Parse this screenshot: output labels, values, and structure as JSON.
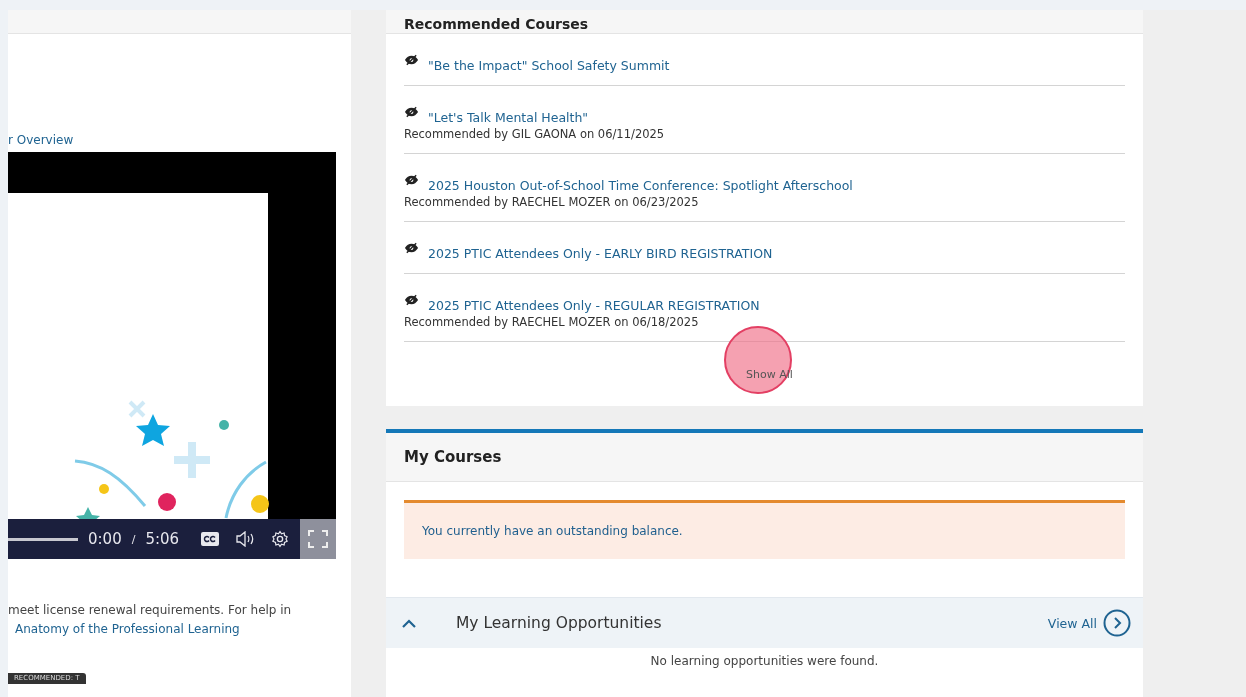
{
  "left_panel": {
    "link": "r Overview",
    "video": {
      "kind": "picture",
      "current_time": "0:00",
      "separator": "/",
      "duration": "5:06"
    },
    "description": "meet license renewal requirements. For help in",
    "description_link": "Anatomy of the Professional Learning",
    "badge": "RECOMMENDED: T"
  },
  "recommended_courses": {
    "title": "Recommended Courses",
    "items": [
      {
        "title": "\"Be the Impact\" School Safety Summit"
      },
      {
        "title": "\"Let's Talk Mental Health\"",
        "recommendation": "Recommended by GIL GAONA on 06/11/2025"
      },
      {
        "title": "2025 Houston Out-of-School Time Conference: Spotlight Afterschool",
        "recommendation": "Recommended by RAECHEL MOZER on 06/23/2025"
      },
      {
        "title": "2025 PTIC Attendees Only - EARLY BIRD REGISTRATION"
      },
      {
        "title": "2025 PTIC Attendees Only - REGULAR REGISTRATION",
        "recommendation": "Recommended by RAECHEL MOZER on 06/18/2025"
      }
    ],
    "show_all": "Show All"
  },
  "my_courses": {
    "title": "My Courses",
    "alert": "You currently have an outstanding balance.",
    "section": {
      "title": "My Learning Opportunities",
      "expanded": true,
      "view_all": "View All",
      "empty": "No learning opportunities were found."
    }
  }
}
